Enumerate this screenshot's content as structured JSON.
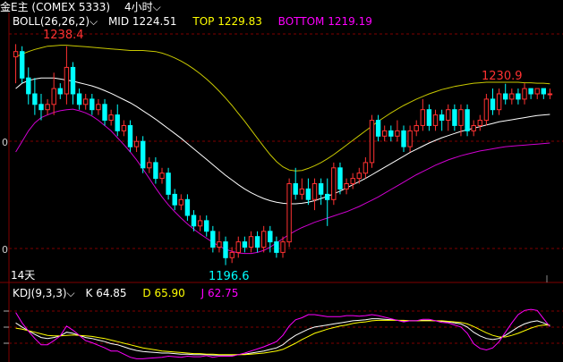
{
  "header": {
    "symbol": "金E主 (COMEX 5333)",
    "period": "4小时",
    "chevron": "⌵"
  },
  "boll_legend": {
    "name": "BOLL(26,26,2)",
    "mid_label": "MID",
    "mid_value": "1224.51",
    "top_label": "TOP",
    "top_value": "1229.83",
    "bottom_label": "BOTTOM",
    "bottom_value": "1219.19",
    "colors": {
      "name": "#ffffff",
      "mid": "#ffffff",
      "top": "#ffff00",
      "bottom": "#ff00ff"
    }
  },
  "annotations": {
    "high_left": "1238.4",
    "low": "1196.6",
    "high_right": "1230.9",
    "period_note": "14天",
    "axis_frag_1": "0",
    "axis_frag_2": "0"
  },
  "kdj_legend": {
    "name": "KDJ(9,3,3)",
    "k_label": "K",
    "k_value": "64.85",
    "d_label": "D",
    "d_value": "65.90",
    "j_label": "J",
    "j_value": "62.75",
    "colors": {
      "k": "#ffffff",
      "d": "#ffff00",
      "j": "#ff00ff"
    }
  },
  "colors": {
    "up": "#ff3232",
    "down": "#00ffff",
    "grid": "#800000",
    "mid": "#ffffff",
    "top": "#c8c800",
    "bottom": "#d000d0",
    "high_label": "#ff3232",
    "low_label": "#00ffff"
  },
  "chart_data": [
    {
      "type": "candlestick",
      "title": "",
      "ylim": [
        1194,
        1241
      ],
      "candles": [
        [
          1236,
          1237,
          1231,
          1238.4
        ],
        [
          1237,
          1232,
          1231,
          1238
        ],
        [
          1232,
          1229,
          1227,
          1234
        ],
        [
          1229,
          1227,
          1225,
          1232
        ],
        [
          1227,
          1226,
          1224,
          1229
        ],
        [
          1226,
          1227,
          1225,
          1228
        ],
        [
          1227,
          1230,
          1225,
          1233
        ],
        [
          1230,
          1229,
          1228,
          1231
        ],
        [
          1229,
          1234,
          1227,
          1238
        ],
        [
          1234,
          1229,
          1227,
          1235
        ],
        [
          1229,
          1227,
          1226,
          1230
        ],
        [
          1227,
          1228,
          1226,
          1229
        ],
        [
          1228,
          1226,
          1225,
          1229
        ],
        [
          1226,
          1227,
          1225,
          1228
        ],
        [
          1227,
          1224,
          1223,
          1228
        ],
        [
          1224,
          1225,
          1223,
          1226
        ],
        [
          1225,
          1222,
          1221,
          1227
        ],
        [
          1222,
          1223,
          1221,
          1224
        ],
        [
          1223,
          1219,
          1218,
          1224
        ],
        [
          1219,
          1220,
          1218,
          1221
        ],
        [
          1220,
          1215,
          1214,
          1221
        ],
        [
          1215,
          1216,
          1214,
          1217
        ],
        [
          1216,
          1213,
          1212,
          1217
        ],
        [
          1213,
          1214,
          1212,
          1215
        ],
        [
          1214,
          1210,
          1209,
          1215
        ],
        [
          1210,
          1208,
          1207,
          1211
        ],
        [
          1208,
          1209,
          1207,
          1210
        ],
        [
          1209,
          1206,
          1205,
          1210
        ],
        [
          1206,
          1204,
          1203,
          1207
        ],
        [
          1204,
          1205,
          1203,
          1206
        ],
        [
          1205,
          1203,
          1202,
          1206
        ],
        [
          1203,
          1200,
          1199,
          1204
        ],
        [
          1200,
          1201,
          1199,
          1203
        ],
        [
          1201,
          1198,
          1196.6,
          1202
        ],
        [
          1198,
          1199,
          1197,
          1200
        ],
        [
          1199,
          1201,
          1198,
          1202
        ],
        [
          1201,
          1200,
          1199,
          1202
        ],
        [
          1200,
          1202,
          1199,
          1203
        ],
        [
          1202,
          1200,
          1199,
          1203
        ],
        [
          1200,
          1203,
          1199,
          1204
        ],
        [
          1203,
          1201,
          1199,
          1204
        ],
        [
          1201,
          1199,
          1198,
          1202
        ],
        [
          1199,
          1201,
          1198,
          1202
        ],
        [
          1201,
          1212,
          1200,
          1213
        ],
        [
          1212,
          1210,
          1209,
          1215
        ],
        [
          1210,
          1211,
          1209,
          1213
        ],
        [
          1211,
          1209,
          1208,
          1213
        ],
        [
          1209,
          1212,
          1207,
          1213
        ],
        [
          1212,
          1210,
          1208,
          1213
        ],
        [
          1210,
          1209,
          1204,
          1213
        ],
        [
          1209,
          1215,
          1208,
          1216
        ],
        [
          1215,
          1211,
          1210,
          1216
        ],
        [
          1211,
          1212,
          1210,
          1213
        ],
        [
          1212,
          1213,
          1211,
          1214
        ],
        [
          1213,
          1214,
          1212,
          1215
        ],
        [
          1214,
          1216,
          1213,
          1217
        ],
        [
          1216,
          1224,
          1215,
          1225
        ],
        [
          1224,
          1221,
          1220,
          1225
        ],
        [
          1221,
          1222,
          1220,
          1223
        ],
        [
          1222,
          1221,
          1220,
          1223
        ],
        [
          1221,
          1222,
          1220,
          1224
        ],
        [
          1222,
          1219,
          1218,
          1223
        ],
        [
          1219,
          1222,
          1218,
          1223
        ],
        [
          1222,
          1223,
          1221,
          1224
        ],
        [
          1223,
          1226,
          1222,
          1228
        ],
        [
          1226,
          1223,
          1222,
          1227
        ],
        [
          1223,
          1225,
          1222,
          1226
        ],
        [
          1225,
          1224,
          1222,
          1226
        ],
        [
          1224,
          1226,
          1222,
          1227
        ],
        [
          1226,
          1223,
          1222,
          1227
        ],
        [
          1223,
          1226,
          1221,
          1227
        ],
        [
          1226,
          1222,
          1221,
          1227
        ],
        [
          1222,
          1223,
          1221,
          1224
        ],
        [
          1223,
          1224,
          1222,
          1225
        ],
        [
          1224,
          1228,
          1223,
          1229
        ],
        [
          1228,
          1226,
          1225,
          1230
        ],
        [
          1226,
          1229,
          1225,
          1230
        ],
        [
          1229,
          1228,
          1227,
          1230.9
        ],
        [
          1228,
          1229,
          1227,
          1230
        ],
        [
          1229,
          1228,
          1227,
          1230
        ],
        [
          1228,
          1230,
          1227,
          1231
        ],
        [
          1230,
          1229,
          1228,
          1230
        ],
        [
          1229,
          1230,
          1228,
          1230
        ],
        [
          1230,
          1229,
          1228,
          1230
        ],
        [
          1229,
          1229,
          1228,
          1230
        ]
      ],
      "mid": [
        1230,
        1231,
        1231.5,
        1231.8,
        1232,
        1232,
        1232,
        1231.8,
        1231.6,
        1231.4,
        1231.1,
        1230.8,
        1230.5,
        1230.1,
        1229.6,
        1229.1,
        1228.5,
        1227.9,
        1227.3,
        1226.6,
        1225.8,
        1225,
        1224.2,
        1223.3,
        1222.4,
        1221.5,
        1220.6,
        1219.6,
        1218.6,
        1217.6,
        1216.6,
        1215.6,
        1214.6,
        1213.6,
        1212.7,
        1211.8,
        1211,
        1210.3,
        1209.7,
        1209.2,
        1208.8,
        1208.5,
        1208.3,
        1208.2,
        1208.2,
        1208.3,
        1208.5,
        1208.8,
        1209.2,
        1209.6,
        1210.1,
        1210.6,
        1211.2,
        1211.8,
        1212.4,
        1213,
        1213.7,
        1214.4,
        1215.1,
        1215.8,
        1216.5,
        1217.2,
        1217.9,
        1218.5,
        1219.1,
        1219.7,
        1220.2,
        1220.7,
        1221.1,
        1221.5,
        1221.9,
        1222.2,
        1222.5,
        1222.8,
        1223.1,
        1223.4,
        1223.7,
        1223.9,
        1224.1,
        1224.3,
        1224.5,
        1224.7,
        1224.9,
        1225,
        1225.1
      ],
      "top": [
        1236,
        1236.5,
        1237,
        1237.4,
        1237.7,
        1238,
        1238.1,
        1238.2,
        1238.2,
        1238.1,
        1238,
        1237.9,
        1237.8,
        1237.7,
        1237.6,
        1237.5,
        1237.4,
        1237.3,
        1237.2,
        1237.2,
        1237.2,
        1237.1,
        1237,
        1236.7,
        1236.3,
        1235.8,
        1235.2,
        1234.5,
        1233.7,
        1232.8,
        1231.8,
        1230.7,
        1229.5,
        1228.2,
        1226.8,
        1225.3,
        1223.8,
        1222.2,
        1220.6,
        1219,
        1217.5,
        1216.2,
        1215.2,
        1214.6,
        1214.4,
        1214.5,
        1214.9,
        1215.4,
        1216,
        1216.7,
        1217.5,
        1218.4,
        1219.3,
        1220.2,
        1221.1,
        1222,
        1222.9,
        1223.8,
        1224.6,
        1225.4,
        1226.1,
        1226.8,
        1227.4,
        1228,
        1228.5,
        1229,
        1229.4,
        1229.8,
        1230.1,
        1230.4,
        1230.6,
        1230.8,
        1231,
        1231.1,
        1231.2,
        1231.2,
        1231.2,
        1231.2,
        1231.2,
        1231.2,
        1231.1,
        1231.1,
        1231,
        1231,
        1230.9
      ],
      "bottom": [
        1218,
        1220,
        1222,
        1223.5,
        1224.5,
        1225,
        1225.5,
        1225.8,
        1226,
        1226.1,
        1225.8,
        1225.4,
        1224.8,
        1224,
        1223,
        1222,
        1220.7,
        1219.4,
        1218,
        1216.5,
        1214.8,
        1213,
        1211.2,
        1209.5,
        1208,
        1206.7,
        1205.5,
        1204.4,
        1203.4,
        1202.5,
        1201.7,
        1200.9,
        1200.2,
        1199.6,
        1199.2,
        1198.9,
        1198.8,
        1198.8,
        1199,
        1199.4,
        1200,
        1200.8,
        1201.6,
        1202.4,
        1203.1,
        1203.7,
        1204.2,
        1204.7,
        1205.1,
        1205.5,
        1205.9,
        1206.3,
        1206.7,
        1207.2,
        1207.7,
        1208.3,
        1208.9,
        1209.5,
        1210.2,
        1210.9,
        1211.6,
        1212.3,
        1213,
        1213.7,
        1214.3,
        1214.9,
        1215.5,
        1216,
        1216.5,
        1216.9,
        1217.3,
        1217.6,
        1217.9,
        1218.2,
        1218.4,
        1218.6,
        1218.8,
        1219,
        1219.1,
        1219.2,
        1219.3,
        1219.4,
        1219.5,
        1219.6,
        1219.7
      ]
    },
    {
      "type": "line",
      "title": "",
      "ylim": [
        0,
        110
      ],
      "series": [
        {
          "name": "K",
          "values": [
            70,
            62,
            55,
            48,
            42,
            40,
            42,
            45,
            52,
            50,
            46,
            42,
            40,
            37,
            34,
            30,
            28,
            24,
            20,
            17,
            15,
            14,
            13,
            12,
            12,
            11,
            10,
            10,
            9,
            9,
            9,
            8,
            8,
            8,
            8,
            9,
            10,
            12,
            14,
            16,
            19,
            22,
            28,
            38,
            46,
            52,
            58,
            62,
            64,
            66,
            68,
            70,
            72,
            74,
            75,
            76,
            78,
            78,
            77,
            76,
            75,
            74,
            74,
            74,
            75,
            75,
            74,
            73,
            72,
            70,
            68,
            62,
            52,
            45,
            40,
            38,
            40,
            46,
            54,
            62,
            68,
            72,
            74,
            70,
            64.85
          ]
        },
        {
          "name": "D",
          "values": [
            60,
            58,
            55,
            52,
            49,
            46,
            45,
            45,
            46,
            47,
            46,
            45,
            44,
            42,
            40,
            37,
            34,
            31,
            28,
            25,
            22,
            20,
            18,
            16,
            15,
            14,
            13,
            12,
            11,
            11,
            10,
            10,
            9,
            9,
            9,
            9,
            9,
            10,
            11,
            12,
            14,
            16,
            19,
            25,
            31,
            38,
            44,
            50,
            54,
            58,
            61,
            64,
            66,
            69,
            71,
            72,
            74,
            75,
            75,
            75,
            75,
            75,
            74,
            74,
            74,
            74,
            74,
            74,
            73,
            72,
            71,
            68,
            63,
            57,
            51,
            46,
            43,
            43,
            46,
            50,
            55,
            60,
            64,
            66,
            65.9
          ]
        },
        {
          "name": "J",
          "values": [
            90,
            70,
            54,
            40,
            28,
            28,
            36,
            45,
            64,
            56,
            46,
            36,
            32,
            27,
            22,
            16,
            16,
            10,
            4,
            1,
            1,
            2,
            3,
            4,
            6,
            5,
            4,
            6,
            5,
            5,
            7,
            4,
            6,
            6,
            6,
            9,
            12,
            16,
            20,
            24,
            29,
            34,
            46,
            64,
            76,
            80,
            86,
            86,
            84,
            82,
            82,
            82,
            84,
            84,
            83,
            84,
            86,
            84,
            81,
            78,
            75,
            72,
            74,
            74,
            77,
            77,
            74,
            71,
            70,
            66,
            62,
            50,
            30,
            21,
            18,
            22,
            34,
            52,
            70,
            86,
            94,
            96,
            94,
            78,
            62.75
          ]
        }
      ]
    }
  ]
}
